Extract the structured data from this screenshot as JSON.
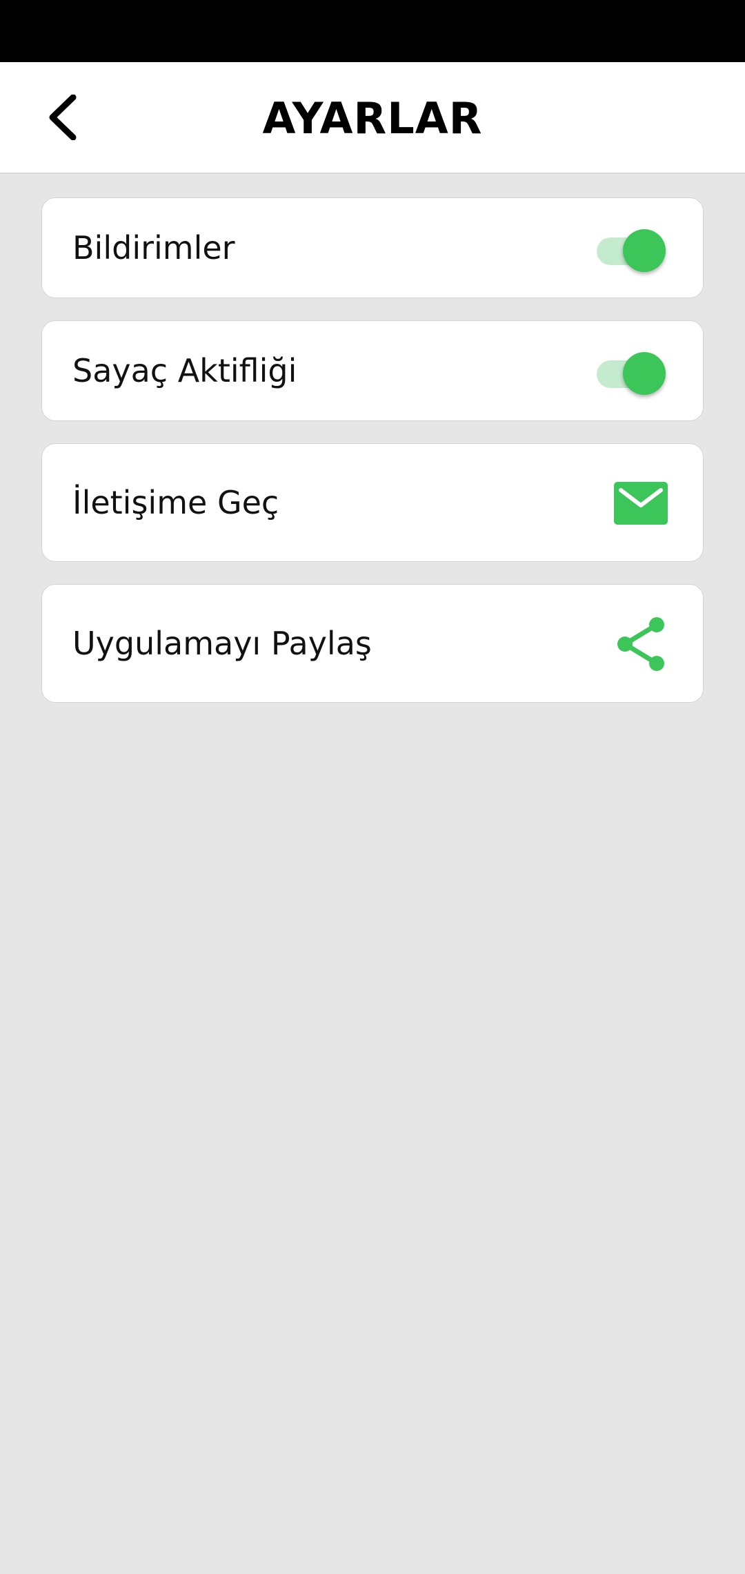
{
  "header": {
    "title": "AYARLAR",
    "back_icon": "chevron-left-icon"
  },
  "settings": [
    {
      "label": "Bildirimler",
      "control": "toggle",
      "enabled": true
    },
    {
      "label": "Sayaç Aktifliği",
      "control": "toggle",
      "enabled": true
    },
    {
      "label": "İletişime Geç",
      "control": "icon",
      "icon": "mail-icon"
    },
    {
      "label": "Uygulamayı Paylaş",
      "control": "icon",
      "icon": "share-icon"
    }
  ],
  "colors": {
    "accent": "#3cc65a",
    "toggle_track": "#c5ebcf",
    "background": "#e6e6e6",
    "card": "#ffffff",
    "status_bar": "#000000"
  }
}
